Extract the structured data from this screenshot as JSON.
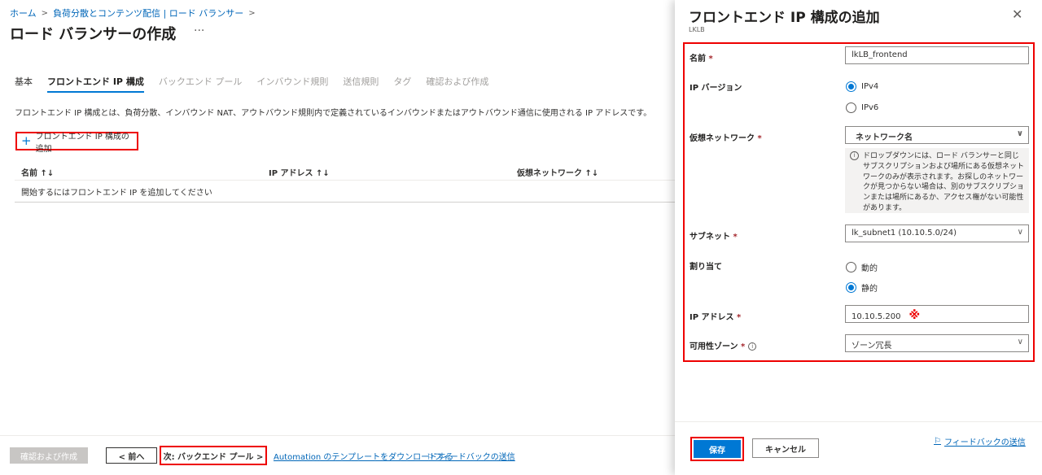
{
  "breadcrumb": [
    "ホーム",
    "負荷分散とコンテンツ配信 | ロード バランサー"
  ],
  "page_title": "ロード バランサーの作成",
  "tabs": [
    "基本",
    "フロントエンド IP 構成",
    "バックエンド プール",
    "インバウンド規則",
    "送信規則",
    "タグ",
    "確認および作成"
  ],
  "description": "フロントエンド IP 構成とは、負荷分散、インバウンド NAT、アウトバウンド規則内で定義されているインバウンドまたはアウトバウンド通信に使用される IP アドレスです。",
  "add_button": "フロントエンド IP 構成の追加",
  "table": {
    "headers": [
      "名前 ↑↓",
      "IP アドレス ↑↓",
      "仮想ネットワーク ↑↓"
    ],
    "empty": "開始するにはフロントエンド IP を追加してください"
  },
  "footer": {
    "review": "確認および作成",
    "prev": "< 前へ",
    "next": "次: バックエンド プール >",
    "automation": "Automation のテンプレートをダウンロードする",
    "feedback": "フィードバックの送信"
  },
  "panel": {
    "title": "フロントエンド IP 構成の追加",
    "subtitle": "LKLB",
    "name_label": "名前",
    "name_value": "lkLB_frontend",
    "ipver_label": "IP バージョン",
    "ipv4": "IPv4",
    "ipv6": "IPv6",
    "vnet_label": "仮想ネットワーク",
    "vnet_value": "ネットワーク名",
    "vnet_info": "ドロップダウンには、ロード バランサーと同じサブスクリプションおよび場所にある仮想ネットワークのみが表示されます。お探しのネットワークが見つからない場合は、別のサブスクリプションまたは場所にあるか、アクセス権がない可能性があります。",
    "subnet_label": "サブネット",
    "subnet_value": "lk_subnet1 (10.10.5.0/24)",
    "assign_label": "割り当て",
    "dynamic": "動的",
    "static": "静的",
    "ip_label": "IP アドレス",
    "ip_value": "10.10.5.200",
    "ip_mark": "※",
    "zone_label": "可用性ゾーン",
    "zone_value": "ゾーン冗長",
    "required_mark": "*",
    "save": "保存",
    "cancel": "キャンセル",
    "feedback": "フィードバックの送信"
  }
}
